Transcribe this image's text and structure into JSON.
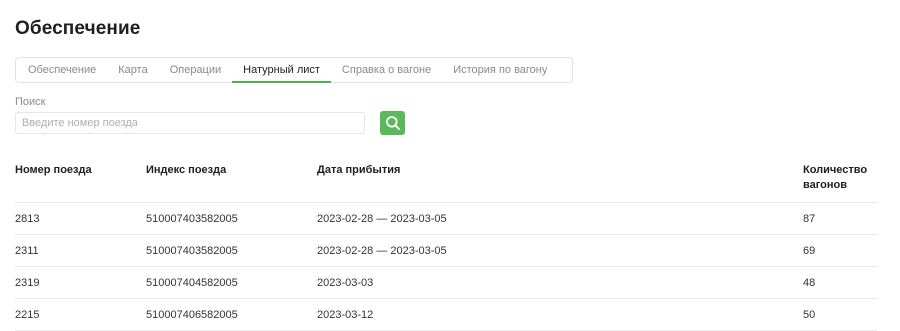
{
  "page": {
    "title": "Обеспечение"
  },
  "tabs": [
    {
      "label": "Обеспечение",
      "active": false
    },
    {
      "label": "Карта",
      "active": false
    },
    {
      "label": "Операции",
      "active": false
    },
    {
      "label": "Натурный лист",
      "active": true
    },
    {
      "label": "Справка о вагоне",
      "active": false
    },
    {
      "label": "История по вагону",
      "active": false
    }
  ],
  "search": {
    "label": "Поиск",
    "placeholder": "Введите номер поезда",
    "value": "",
    "button_icon": "search-icon"
  },
  "colors": {
    "accent": "#4caf50",
    "button": "#5cb85c"
  },
  "table": {
    "headers": [
      "Номер поезда",
      "Индекс поезда",
      "Дата прибытия",
      "Количество вагонов"
    ],
    "rows": [
      [
        "2813",
        "510007403582005",
        "2023-02-28 — 2023-03-05",
        "87"
      ],
      [
        "2311",
        "510007403582005",
        "2023-02-28 — 2023-03-05",
        "69"
      ],
      [
        "2319",
        "510007404582005",
        "2023-03-03",
        "48"
      ],
      [
        "2215",
        "510007406582005",
        "2023-03-12",
        "50"
      ]
    ]
  }
}
